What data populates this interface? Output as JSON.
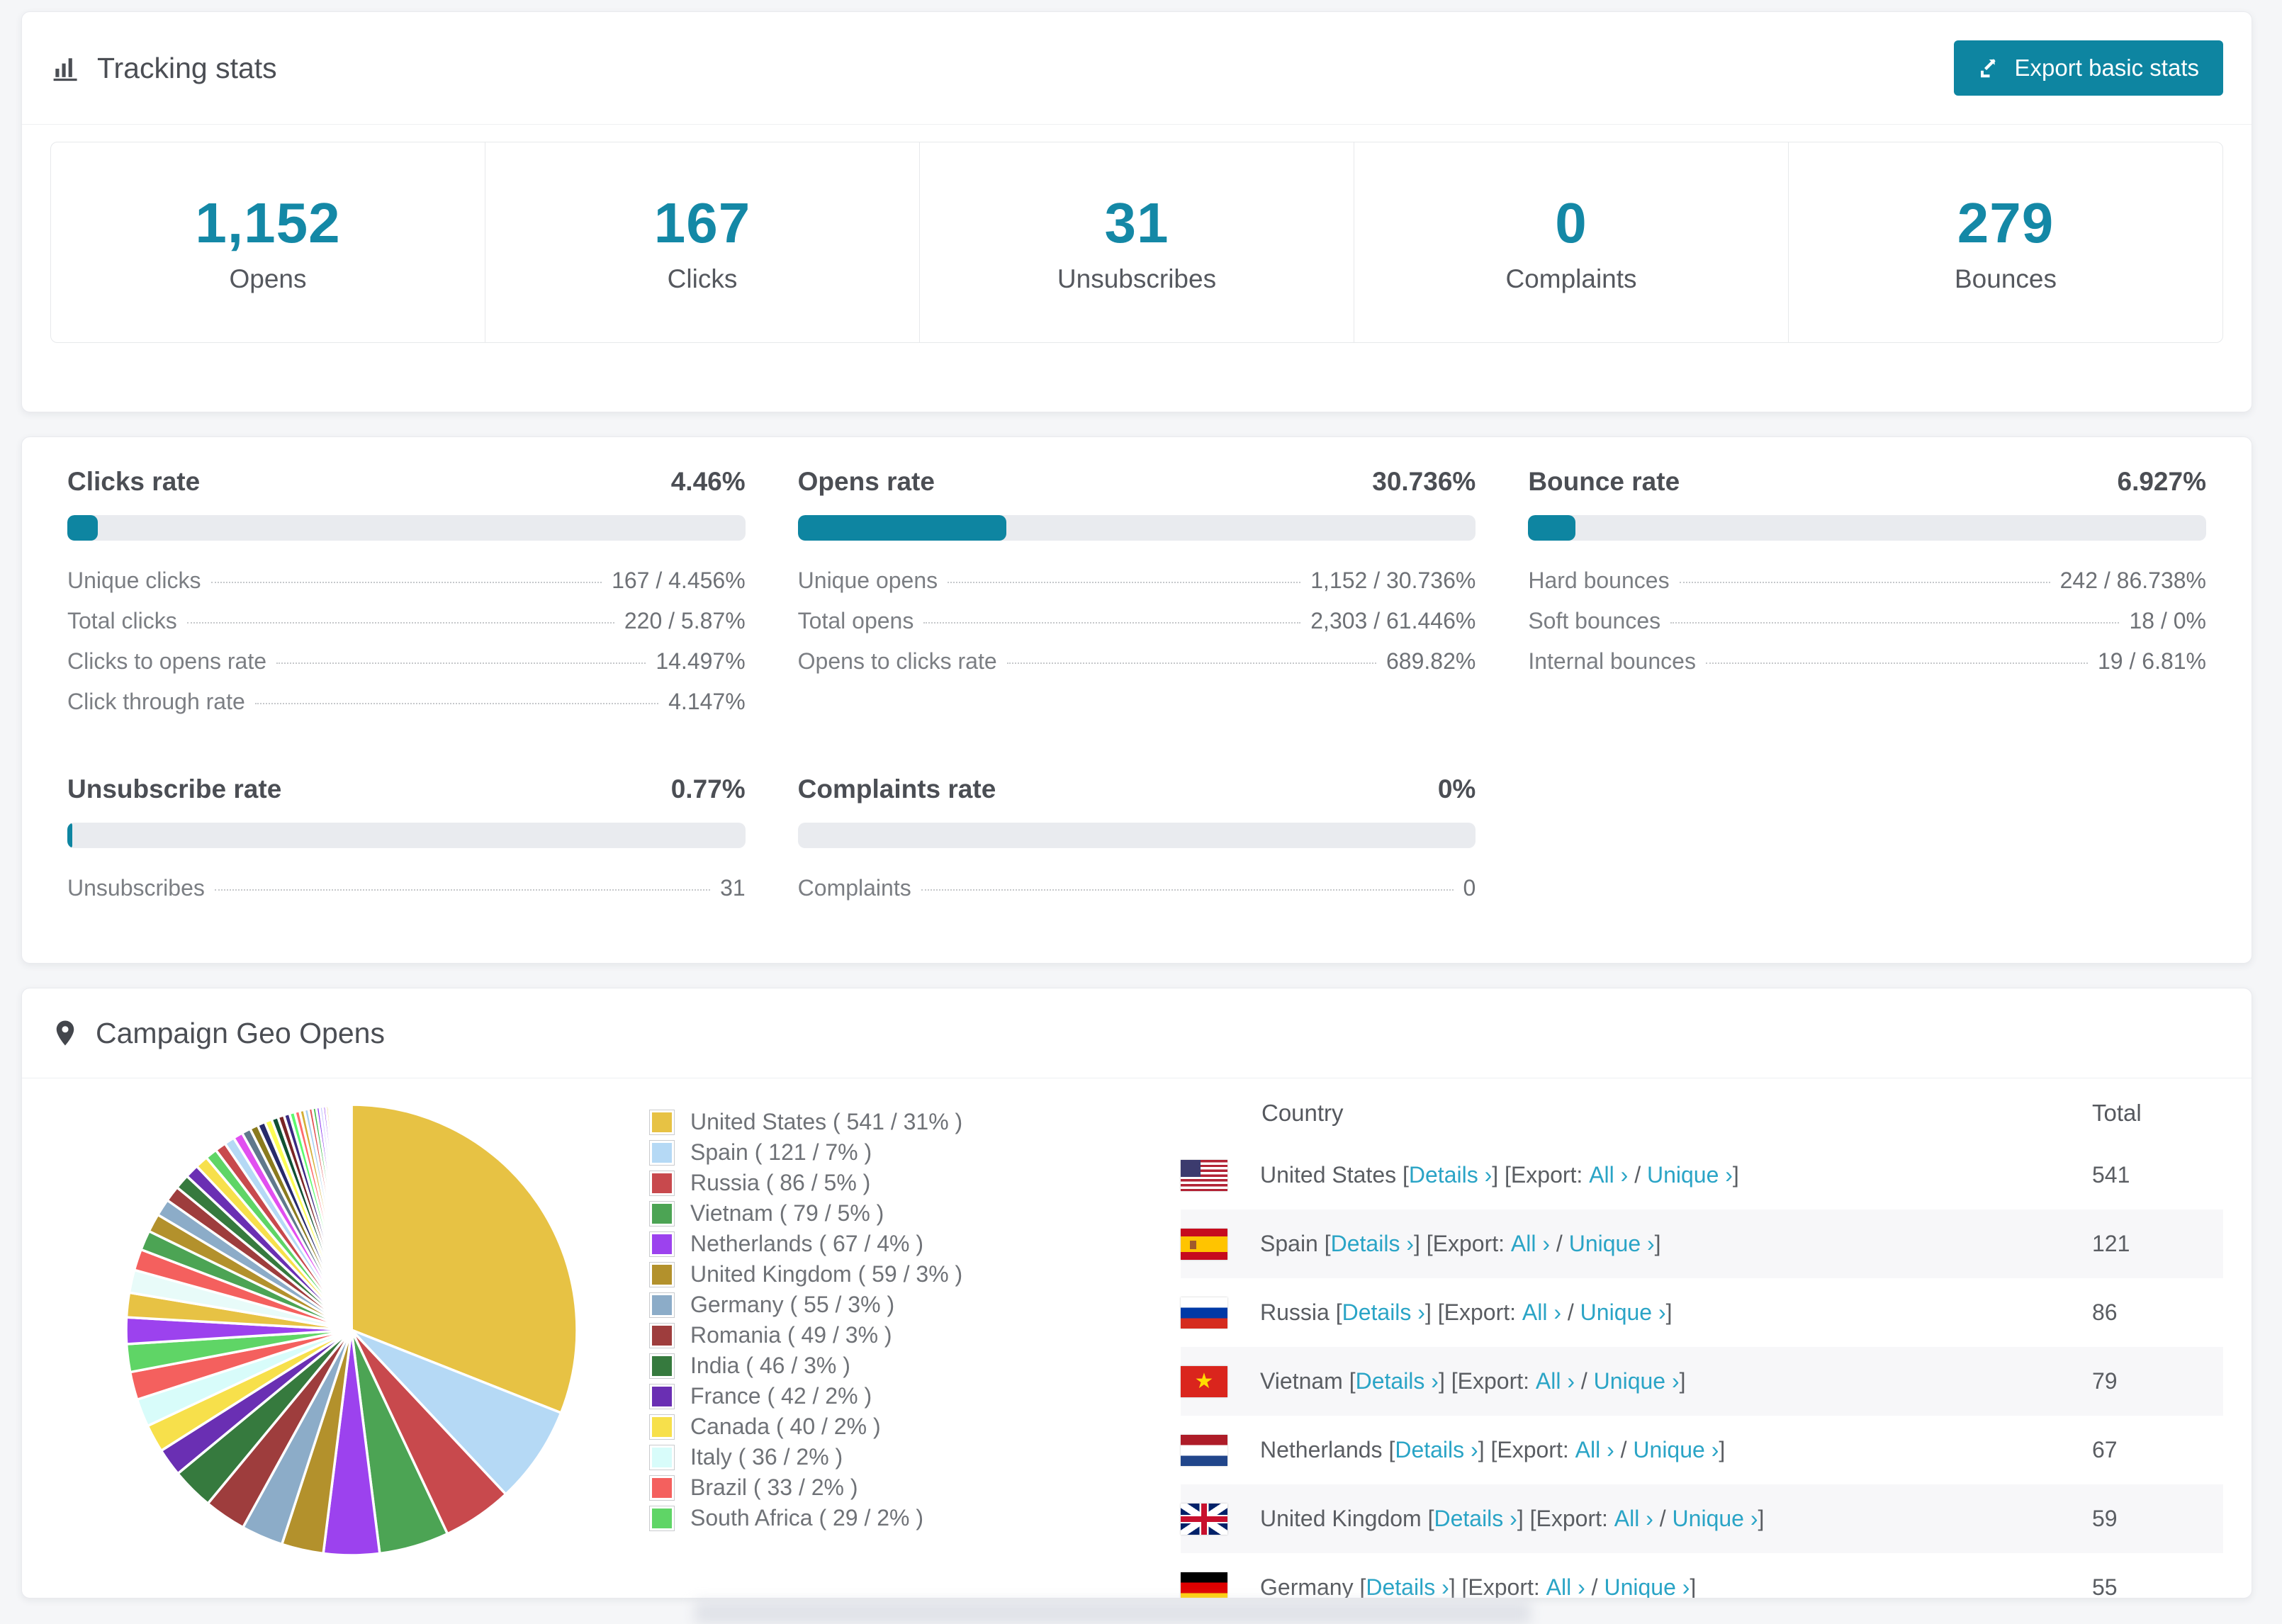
{
  "colors": {
    "accent": "#0e85a1",
    "stat_number": "#1488a6",
    "link": "#2aa4c6",
    "bar_track": "#e9ebef"
  },
  "tracking": {
    "title": "Tracking stats",
    "export_button": {
      "label": "Export basic stats"
    },
    "stats": [
      {
        "value": "1,152",
        "label": "Opens"
      },
      {
        "value": "167",
        "label": "Clicks"
      },
      {
        "value": "31",
        "label": "Unsubscribes"
      },
      {
        "value": "0",
        "label": "Complaints"
      },
      {
        "value": "279",
        "label": "Bounces"
      }
    ]
  },
  "rates": {
    "sections": [
      {
        "title": "Clicks rate",
        "value": "4.46%",
        "bar_pct": 4.46,
        "rows": [
          {
            "label": "Unique clicks",
            "value": "167 / 4.456%"
          },
          {
            "label": "Total clicks",
            "value": "220 / 5.87%"
          },
          {
            "label": "Clicks to opens rate",
            "value": "14.497%"
          },
          {
            "label": "Click through rate",
            "value": "4.147%"
          }
        ]
      },
      {
        "title": "Opens rate",
        "value": "30.736%",
        "bar_pct": 30.736,
        "rows": [
          {
            "label": "Unique opens",
            "value": "1,152 / 30.736%"
          },
          {
            "label": "Total opens",
            "value": "2,303 / 61.446%"
          },
          {
            "label": "Opens to clicks rate",
            "value": "689.82%"
          }
        ]
      },
      {
        "title": "Bounce rate",
        "value": "6.927%",
        "bar_pct": 6.927,
        "rows": [
          {
            "label": "Hard bounces",
            "value": "242 / 86.738%"
          },
          {
            "label": "Soft bounces",
            "value": "18 / 0%"
          },
          {
            "label": "Internal bounces",
            "value": "19 / 6.81%"
          }
        ]
      },
      {
        "title": "Unsubscribe rate",
        "value": "0.77%",
        "bar_pct": 0.77,
        "rows": [
          {
            "label": "Unsubscribes",
            "value": "31"
          }
        ]
      },
      {
        "title": "Complaints rate",
        "value": "0%",
        "bar_pct": 0,
        "rows": [
          {
            "label": "Complaints",
            "value": "0"
          }
        ]
      }
    ]
  },
  "geo": {
    "title": "Campaign Geo Opens",
    "legend": [
      {
        "label": "United States ( 541 / 31% )",
        "color": "#e7c244"
      },
      {
        "label": "Spain ( 121 / 7% )",
        "color": "#b5d9f5"
      },
      {
        "label": "Russia ( 86 / 5% )",
        "color": "#c8494d"
      },
      {
        "label": "Vietnam ( 79 / 5% )",
        "color": "#4ca454"
      },
      {
        "label": "Netherlands ( 67 / 4% )",
        "color": "#9c42ee"
      },
      {
        "label": "United Kingdom ( 59 / 3% )",
        "color": "#b3912c"
      },
      {
        "label": "Germany ( 55 / 3% )",
        "color": "#8cacc8"
      },
      {
        "label": "Romania ( 49 / 3% )",
        "color": "#9e3d3d"
      },
      {
        "label": "India ( 46 / 3% )",
        "color": "#367a3e"
      },
      {
        "label": "France ( 42 / 2% )",
        "color": "#6a2fb3"
      },
      {
        "label": "Canada ( 40 / 2% )",
        "color": "#f7e04b"
      },
      {
        "label": "Italy ( 36 / 2% )",
        "color": "#d8fcfa"
      },
      {
        "label": "Brazil ( 33 / 2% )",
        "color": "#f4605e"
      },
      {
        "label": "South Africa ( 29 / 2% )",
        "color": "#5fd566"
      }
    ],
    "table": {
      "headers": {
        "country": "Country",
        "total": "Total"
      },
      "links": {
        "details": "Details",
        "export": "Export:",
        "all": "All",
        "unique": "Unique",
        "chevron": "›"
      },
      "rows": [
        {
          "flag": "us",
          "country": "United States",
          "total": "541"
        },
        {
          "flag": "es",
          "country": "Spain",
          "total": "121"
        },
        {
          "flag": "ru",
          "country": "Russia",
          "total": "86"
        },
        {
          "flag": "vn",
          "country": "Vietnam",
          "total": "79"
        },
        {
          "flag": "nl",
          "country": "Netherlands",
          "total": "67"
        },
        {
          "flag": "gb",
          "country": "United Kingdom",
          "total": "59"
        },
        {
          "flag": "de",
          "country": "Germany",
          "total": "55"
        }
      ]
    }
  },
  "chart_data": {
    "type": "pie",
    "title": "Campaign Geo Opens",
    "legend_position": "right",
    "start_angle_deg": -90,
    "direction": "clockwise",
    "slices": [
      {
        "name": "United States",
        "value": 541,
        "pct": 31,
        "color": "#e7c244"
      },
      {
        "name": "Spain",
        "value": 121,
        "pct": 7,
        "color": "#b5d9f5"
      },
      {
        "name": "Russia",
        "value": 86,
        "pct": 5,
        "color": "#c8494d"
      },
      {
        "name": "Vietnam",
        "value": 79,
        "pct": 5,
        "color": "#4ca454"
      },
      {
        "name": "Netherlands",
        "value": 67,
        "pct": 4,
        "color": "#9c42ee"
      },
      {
        "name": "United Kingdom",
        "value": 59,
        "pct": 3,
        "color": "#b3912c"
      },
      {
        "name": "Germany",
        "value": 55,
        "pct": 3,
        "color": "#8cacc8"
      },
      {
        "name": "Romania",
        "value": 49,
        "pct": 3,
        "color": "#9e3d3d"
      },
      {
        "name": "India",
        "value": 46,
        "pct": 3,
        "color": "#367a3e"
      },
      {
        "name": "France",
        "value": 42,
        "pct": 2,
        "color": "#6a2fb3"
      },
      {
        "name": "Canada",
        "value": 40,
        "pct": 2,
        "color": "#f7e04b"
      },
      {
        "name": "Italy",
        "value": 36,
        "pct": 2,
        "color": "#d8fcfa"
      },
      {
        "name": "Brazil",
        "value": 33,
        "pct": 2,
        "color": "#f4605e"
      },
      {
        "name": "South Africa",
        "value": 29,
        "pct": 2,
        "color": "#5fd566"
      }
    ],
    "others": {
      "note": "many small unlabeled countries",
      "total_pct": 26,
      "count": 45,
      "decay": 0.93,
      "palette": [
        "#9c42ee",
        "#e7c244",
        "#e8fbf9",
        "#f4605e",
        "#4ca454",
        "#b3912c",
        "#8cacc8",
        "#9e3d3d",
        "#367a3e",
        "#6a2fb3",
        "#f7e04b",
        "#5fd566",
        "#c8494d",
        "#b5d9f5",
        "#e14ff0",
        "#60788c",
        "#8a7a1e",
        "#272a6b",
        "#fdfd55",
        "#0f5132",
        "#7a2525",
        "#3a2a80",
        "#5dfa6e",
        "#ff6b6b",
        "#d4af37",
        "#a8d0f0",
        "#e05252",
        "#3dbb4a",
        "#8833ee",
        "#c0c0ff"
      ]
    }
  }
}
